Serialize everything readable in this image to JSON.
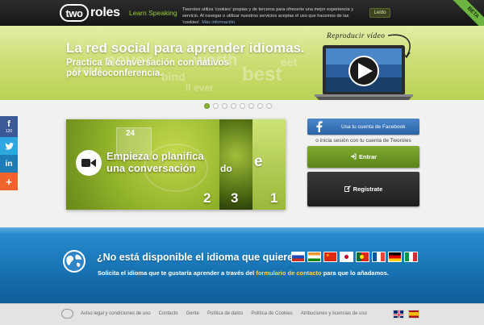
{
  "header": {
    "logo_badge": "two",
    "logo_text": "roles",
    "tagline": "Learn Speaking",
    "cookie_notice": "Tworoles utiliza 'cookies' propias y de terceros para ofrecerte una mejor experiencia y servicio. Al navegar o utilizar nuestros servicios aceptas el uso que hacemos de las 'cookies'.",
    "cookie_more_link": "Más información",
    "cookie_ok_button": "Leído",
    "beta_ribbon": "BETA"
  },
  "hero": {
    "title": "La red social para aprender idiomas.",
    "subtitle": "Practica la conversación con nativos por videoconferencia.",
    "video_link": "Reproducir vídeo",
    "slider_dots": 8,
    "active_slide": 1
  },
  "main": {
    "panel_action": "Empieza o planifica una conversación",
    "panel_fragment_2": "do",
    "panel_fragment_3": "e",
    "panel_numbers": [
      "2",
      "3",
      "1"
    ],
    "calendar_day": "24"
  },
  "login": {
    "facebook_button": "Usa tu cuenta de Facebook",
    "or_text": "o inicia sesión con tu cuenta de Tworoles",
    "enter_button": "Entrar",
    "register_button": "Registrate"
  },
  "share": {
    "facebook_count": "120"
  },
  "languages": {
    "title": "¿No está disponible el idioma que quieres?",
    "request_before": "Solicita el idioma que te gustaría aprender a través del",
    "request_link": "formulario de contacto",
    "request_after": "para que lo añadamos.",
    "flags": [
      "russian",
      "indian",
      "chinese",
      "japanese",
      "portuguese",
      "french",
      "german",
      "italian"
    ]
  },
  "footer": {
    "links": [
      "Aviso legal y condiciones de uso",
      "Contacto",
      "Gente",
      "Política de datos",
      "Política de Cookies",
      "Atribuciones y licencias de uso"
    ],
    "language_flags": [
      "english",
      "spanish"
    ]
  },
  "colors": {
    "brand_green": "#7eab30",
    "facebook_blue": "#3b5998",
    "section_blue": "#1873b4"
  }
}
